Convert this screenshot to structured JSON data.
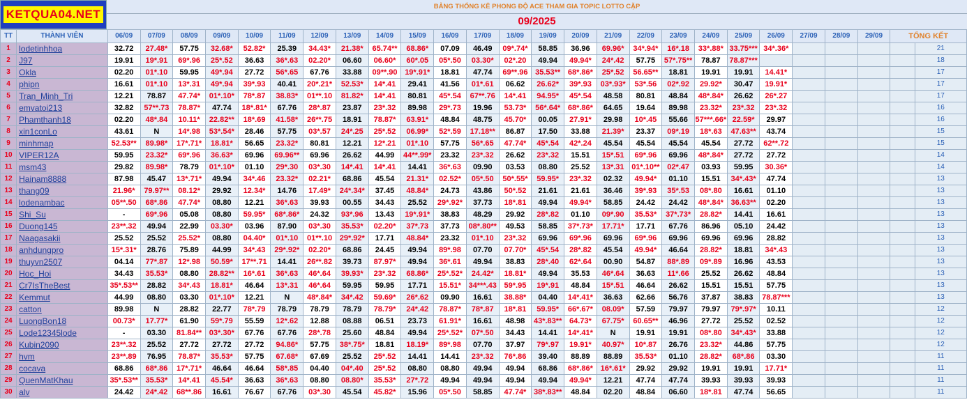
{
  "logo_text": "KETQUA04.NET",
  "title": "BẢNG THỐNG KÊ PHONG ĐỘ ACE THAM GIA TOPIC  LOTTO CẶP",
  "month": "09/2025",
  "headers": {
    "tt": "TT",
    "member": "THÀNH VIÊN",
    "total": "TỔNG KẾT",
    "dates": [
      "06/09",
      "07/09",
      "08/09",
      "09/09",
      "10/09",
      "11/09",
      "12/09",
      "13/09",
      "14/09",
      "15/09",
      "16/09",
      "17/09",
      "18/09",
      "19/09",
      "20/09",
      "21/09",
      "22/09",
      "23/09",
      "24/09",
      "25/09",
      "26/09",
      "27/09",
      "28/09",
      "29/09"
    ]
  },
  "colors": {
    "hit": "#e8001c",
    "normal": "#000000",
    "name": "#1d3f9a",
    "total": "#2d62b7"
  },
  "rows": [
    {
      "tt": "1",
      "name": "lodetinhhoa",
      "cells": [
        "32.72",
        "27.48*",
        "57.75",
        "32.68*",
        "52.82*",
        "25.39",
        "34.43*",
        "21.38*",
        "65.74**",
        "68.86*",
        "07.09",
        "46.49",
        "09*.74*",
        "58.85",
        "36.96",
        "69.96*",
        "34*.94*",
        "16*.18",
        "33*.88*",
        "33.75***",
        "34*.36*"
      ],
      "total": "21"
    },
    {
      "tt": "2",
      "name": "J97",
      "cells": [
        "19.91",
        "19*.91",
        "69*.96",
        "25*.52",
        "36.63",
        "36*.63",
        "02.20*",
        "06.60",
        "06.60*",
        "60*.05",
        "05*.50",
        "03.30*",
        "02*.20",
        "49.94",
        "49.94*",
        "24*.42",
        "57.75",
        "57*.75**",
        "78.87",
        "78.87***"
      ],
      "total": "18"
    },
    {
      "tt": "3",
      "name": "Okla",
      "cells": [
        "02.20",
        "01*.10",
        "59.95",
        "49*.94",
        "27.72",
        "56*.65",
        "67.76",
        "33.88",
        "09**.90",
        "19*.91*",
        "18.81",
        "47.74",
        "69**.96",
        "35.53**",
        "68*.86*",
        "25*.52",
        "56.65**",
        "18.81",
        "19.91",
        "19.91",
        "14.41*"
      ],
      "total": "17"
    },
    {
      "tt": "4",
      "name": "phipn",
      "cells": [
        "16.61",
        "01*.10",
        "13*.31",
        "49*.94",
        "39*.93",
        "40.41",
        "20*.21*",
        "52.53*",
        "14*.41",
        "29.41",
        "41.56",
        "01*.61",
        "06.62",
        "26.62*",
        "39*.93",
        "03*.93*",
        "53*.56",
        "02*.92",
        "29.92*",
        "30.47",
        "19.91*"
      ],
      "total": "17"
    },
    {
      "tt": "5",
      "name": "Tran_Minh_Tri",
      "cells": [
        "12.21",
        "78.87",
        "47.74*",
        "01*.10*",
        "78*.87",
        "38.83*",
        "01**.10",
        "81.82*",
        "14*.41",
        "80.81",
        "45*.54",
        "67**.76",
        "14*.41",
        "94.95*",
        "45*.54",
        "48.58",
        "80.81",
        "48.84",
        "48*.84*",
        "26.62",
        "26*.27"
      ],
      "total": "17"
    },
    {
      "tt": "6",
      "name": "emvatoi213",
      "cells": [
        "32.82",
        "57**.73",
        "78.87*",
        "47.74",
        "18*.81*",
        "67.76",
        "28*.87",
        "23.87",
        "23*.32",
        "89.98",
        "29*.73",
        "19.96",
        "53.73*",
        "56*.64*",
        "68*.86*",
        "64.65",
        "19.64",
        "89.98",
        "23.32*",
        "23*.32",
        "23*.32"
      ],
      "total": "16"
    },
    {
      "tt": "7",
      "name": "Phamthanh18",
      "cells": [
        "02.20",
        "48*.84",
        "10.11*",
        "22.82**",
        "18*.69",
        "41.58*",
        "26**.75",
        "18.91",
        "78.87*",
        "63.91*",
        "48.84",
        "48.75",
        "45.70*",
        "00.05",
        "27.91*",
        "29.98",
        "10*.45",
        "55.66",
        "57***.66*",
        "22.59*",
        "29.97"
      ],
      "total": "16"
    },
    {
      "tt": "8",
      "name": "xin1conLo",
      "cells": [
        "43.61",
        "N",
        "14*.98",
        "53*.54*",
        "28.46",
        "57.75",
        "03*.57",
        "24*.25",
        "25*.52",
        "06.99*",
        "52*.59",
        "17.18**",
        "86.87",
        "17.50",
        "33.88",
        "21.39*",
        "23.37",
        "09*.19",
        "18*.63",
        "47.63**",
        "43.74"
      ],
      "total": "15"
    },
    {
      "tt": "9",
      "name": "minhmap",
      "cells": [
        "52.53**",
        "89.98*",
        "17*.71*",
        "18.81*",
        "56.65",
        "23.32*",
        "80.81",
        "12.21",
        "12*.21",
        "01*.10",
        "57.75",
        "56*.65",
        "47.74*",
        "45*.54",
        "42*.24",
        "45.54",
        "45.54",
        "45.54",
        "45.54",
        "27.72",
        "62**.72"
      ],
      "total": "15"
    },
    {
      "tt": "10",
      "name": "VIPER12A",
      "cells": [
        "59.95",
        "23.32*",
        "69*.96",
        "36.63*",
        "69.96",
        "69.96**",
        "69.96",
        "26.62",
        "44.99",
        "44**.99*",
        "23.32",
        "23*.32",
        "26.62",
        "23*.32",
        "15.51",
        "15*.51",
        "69*.96",
        "69.96",
        "48*.84*",
        "27.72",
        "27.72"
      ],
      "total": "14"
    },
    {
      "tt": "11",
      "name": "msm43",
      "cells": [
        "29.82",
        "89.98*",
        "78.79",
        "01*.10*",
        "01.10",
        "29*.30",
        "03*.30",
        "14*.41",
        "14*.41",
        "14.41",
        "36*.63",
        "09.90",
        "03.53",
        "08.80",
        "25.52",
        "13*.31",
        "01*.10**",
        "02*.47",
        "03.93",
        "59.95",
        "30.36*"
      ],
      "total": "14"
    },
    {
      "tt": "12",
      "name": "Hainam8888",
      "cells": [
        "87.98",
        "45.47",
        "13*.71*",
        "49.94",
        "34*.46",
        "23.32*",
        "02.21*",
        "68.86",
        "45.54",
        "21.31*",
        "02.52*",
        "05*.50",
        "50*.55*",
        "59.95*",
        "23*.32",
        "02.32",
        "49.94*",
        "01.10",
        "15.51",
        "34*.43*",
        "47.74"
      ],
      "total": "13"
    },
    {
      "tt": "13",
      "name": "thang09",
      "cells": [
        "21.96*",
        "79.97**",
        "08.12*",
        "29.92",
        "12.34*",
        "14.76",
        "17.49*",
        "24*.34*",
        "37.45",
        "48.84*",
        "24.73",
        "43.86",
        "50*.52",
        "21.61",
        "21.61",
        "36.46",
        "39*.93",
        "35*.53",
        "08*.80",
        "16.61",
        "01.10"
      ],
      "total": "13"
    },
    {
      "tt": "14",
      "name": "lodenambac",
      "cells": [
        "05**.50",
        "68*.86",
        "47.74*",
        "08.80",
        "12.21",
        "36*.63",
        "39.93",
        "00.55",
        "34.43",
        "25.52",
        "29*.92*",
        "37.73",
        "18*.81",
        "49.94",
        "49.94*",
        "58.85",
        "24.42",
        "24.42",
        "48*.84*",
        "36.63**",
        "02.20"
      ],
      "total": "13"
    },
    {
      "tt": "15",
      "name": "Shi_Su",
      "cells": [
        "-",
        "69*.96",
        "05.08",
        "08.80",
        "59.95*",
        "68*.86*",
        "24.32",
        "93*.96",
        "13.43",
        "19*.91*",
        "38.83",
        "48.29",
        "29.92",
        "28*.82",
        "01.10",
        "09*.90",
        "35.53*",
        "37*.73*",
        "28.82*",
        "14.41",
        "16.61"
      ],
      "total": "13"
    },
    {
      "tt": "16",
      "name": "Duong145",
      "cells": [
        "23**.32",
        "49.94",
        "22.99",
        "03.30*",
        "03.96",
        "87.90",
        "03*.30",
        "35.53*",
        "02.20*",
        "37*.73",
        "37.73",
        "08*.80**",
        "49.53",
        "58.85",
        "37*.73*",
        "17.71*",
        "17.71",
        "67.76",
        "86.96",
        "05.10",
        "24.42"
      ],
      "total": "13"
    },
    {
      "tt": "17",
      "name": "Naagasakii",
      "cells": [
        "25.52",
        "25.52",
        "25.52*",
        "08.80",
        "04.40*",
        "01*.10",
        "01**.10",
        "29*.92*",
        "17.71",
        "48.84*",
        "23.32",
        "01*.10",
        "23*.32",
        "69.96",
        "69*.96",
        "69.96",
        "69*.96",
        "69.96",
        "69.96",
        "69.96",
        "28.82"
      ],
      "total": "13"
    },
    {
      "tt": "18",
      "name": "anhdungpro",
      "cells": [
        "15*.31*",
        "28.76",
        "75.89",
        "44.99",
        "34*.43",
        "29*.92*",
        "02.20*",
        "68.86",
        "24.45",
        "49.94",
        "89*.98",
        "07.70",
        "07.70*",
        "45*.54",
        "28*.82",
        "45.54",
        "49.94*",
        "46.64",
        "28.82*",
        "18.81",
        "34*.43"
      ],
      "total": "13"
    },
    {
      "tt": "19",
      "name": "thuyvn2507",
      "cells": [
        "04.14",
        "77*.87",
        "12*.98",
        "50.59*",
        "17**.71",
        "14.41",
        "26**.82",
        "39.73",
        "87.97*",
        "49.94",
        "36*.61",
        "49.94",
        "38.83",
        "28*.40",
        "62*.64",
        "00.90",
        "54.87",
        "88*.89",
        "09*.89",
        "16.96",
        "43.53"
      ],
      "total": "13"
    },
    {
      "tt": "20",
      "name": "Hoc_Hoi",
      "cells": [
        "34.43",
        "35.53*",
        "08.80",
        "28.82**",
        "16*.61",
        "36*.63",
        "46*.64",
        "39.93*",
        "23*.32",
        "68.86*",
        "25*.52*",
        "24.42*",
        "18.81*",
        "49.94",
        "35.53",
        "46*.64",
        "36.63",
        "11*.66",
        "25.52",
        "26.62",
        "48.84"
      ],
      "total": "13"
    },
    {
      "tt": "21",
      "name": "Cr7IsTheBest",
      "cells": [
        "35*.53**",
        "28.82",
        "34*.43",
        "18.81*",
        "46.64",
        "13*.31",
        "46*.64",
        "59.95",
        "59.95",
        "17.71",
        "15.51*",
        "34***.43",
        "59*.95",
        "19*.91",
        "48.84",
        "15*.51",
        "46.64",
        "26.62",
        "15.51",
        "15.51",
        "57.75"
      ],
      "total": "13"
    },
    {
      "tt": "22",
      "name": "Kemmut",
      "cells": [
        "44.99",
        "08.80",
        "03.30",
        "01*.10*",
        "12.21",
        "N",
        "48*.84*",
        "34*.42",
        "59.69*",
        "26*.62",
        "09.90",
        "16.61",
        "38.88*",
        "04.40",
        "14*.41*",
        "36.63",
        "62.66",
        "56.76",
        "37.87",
        "38.83",
        "78.87***"
      ],
      "total": "13"
    },
    {
      "tt": "23",
      "name": "catton",
      "cells": [
        "89.98",
        "N",
        "28.82",
        "22.77",
        "78*.79",
        "78.79",
        "78.79",
        "78.79",
        "78.79*",
        "24*.42",
        "78.87*",
        "78*.87",
        "18*.81",
        "59.95*",
        "66*.67*",
        "08.09*",
        "57.59",
        "79.97",
        "79.97",
        "79*.97*",
        "10.11"
      ],
      "total": "12"
    },
    {
      "tt": "24",
      "name": "LuongBon18",
      "cells": [
        "00.73*",
        "17.77*",
        "61.90",
        "59*.79",
        "55.59",
        "12*.62",
        "12.88",
        "08.88",
        "06.51",
        "23.73",
        "61.91*",
        "16.61",
        "48.98",
        "43*.83**",
        "64.73*",
        "67.75*",
        "60.65**",
        "46.96",
        "27.72",
        "25.52",
        "02.52"
      ],
      "total": "12"
    },
    {
      "tt": "25",
      "name": "Lode12345lode",
      "cells": [
        "-",
        "03.30",
        "81.84**",
        "03*.30*",
        "67.76",
        "67.76",
        "28*.78",
        "25.60",
        "48.84",
        "49.94",
        "25*.52*",
        "07*.50",
        "34.43",
        "14.41",
        "14*.41*",
        "N",
        "19.91",
        "19.91",
        "08*.80",
        "34*.43*",
        "33.88"
      ],
      "total": "12"
    },
    {
      "tt": "26",
      "name": "Kubin2090",
      "cells": [
        "23**.32",
        "25.52",
        "27.72",
        "27.72",
        "27.72",
        "94.86*",
        "57.75",
        "38*.75*",
        "18.81",
        "18.19*",
        "89*.98",
        "07.70",
        "37.97",
        "79*.97",
        "19.91*",
        "40.97*",
        "10*.87",
        "26.76",
        "23.32*",
        "44.86",
        "57.75"
      ],
      "total": "12"
    },
    {
      "tt": "27",
      "name": "hvm",
      "cells": [
        "23**.89",
        "76.95",
        "78.87*",
        "35.53*",
        "57.75",
        "67.68*",
        "67.69",
        "25.52",
        "25*.52",
        "14.41",
        "14.41",
        "23*.32",
        "76*.86",
        "39.40",
        "88.89",
        "88.89",
        "35.53*",
        "01.10",
        "28.82*",
        "68*.86",
        "03.30"
      ],
      "total": "11"
    },
    {
      "tt": "28",
      "name": "cocava",
      "cells": [
        "68.86",
        "68*.86",
        "17*.71*",
        "46.64",
        "46.64",
        "58*.85",
        "04.40",
        "04*.40",
        "25*.52",
        "08.80",
        "08.80",
        "49.94",
        "49.94",
        "68.86",
        "68*.86*",
        "16*.61*",
        "29.92",
        "29.92",
        "19.91",
        "19.91",
        "17.71*"
      ],
      "total": "11"
    },
    {
      "tt": "29",
      "name": "QuenMatKhau",
      "cells": [
        "35*.53**",
        "35.53*",
        "14*.41",
        "45.54*",
        "36.63",
        "36*.63",
        "08.80",
        "08.80*",
        "35.53*",
        "27*.72",
        "49.94",
        "49.94",
        "49.94",
        "49.94",
        "49.94*",
        "12.21",
        "47.74",
        "47.74",
        "39.93",
        "39.93",
        "39.93"
      ],
      "total": "11"
    },
    {
      "tt": "30",
      "name": "alv",
      "cells": [
        "24.42",
        "24*.42",
        "68**.86",
        "16.61",
        "76.67",
        "67.76",
        "03*.30",
        "45.54",
        "45.82*",
        "15.96",
        "05*.50",
        "58.85",
        "47.74*",
        "38*.83**",
        "48.84",
        "02.20",
        "48.84",
        "06.60",
        "18*.81",
        "47.74",
        "56.65"
      ],
      "total": "11"
    }
  ]
}
